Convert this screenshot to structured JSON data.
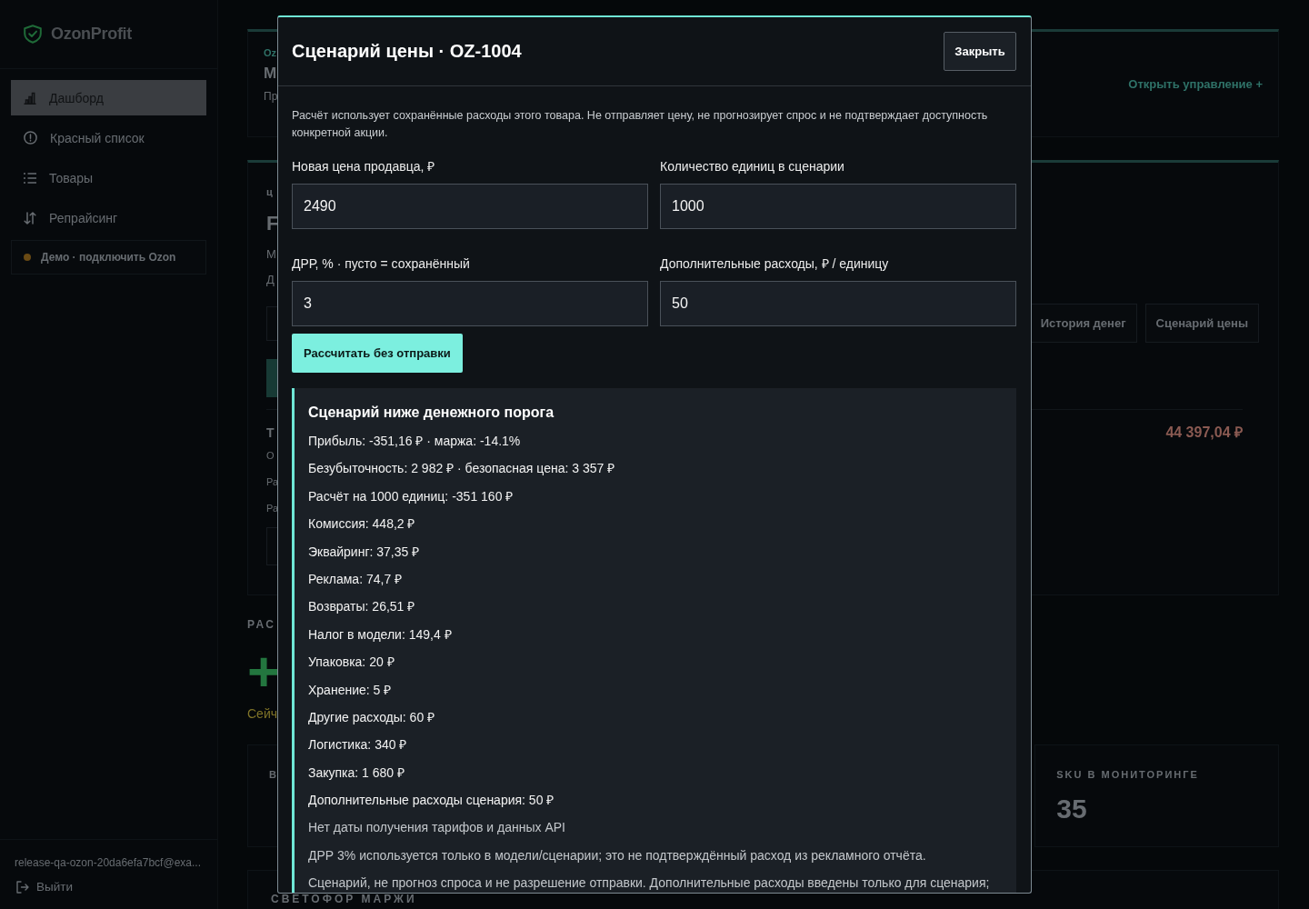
{
  "sidebar": {
    "logo": "OzonProfit",
    "items": [
      {
        "label": "Дашборд",
        "selected": true
      },
      {
        "label": "Красный список",
        "selected": false
      },
      {
        "label": "Товары",
        "selected": false
      },
      {
        "label": "Репрайсинг",
        "selected": false
      }
    ],
    "demo": {
      "label": "Демо · подключить Ozon",
      "color": "#6a4a14"
    },
    "user_email": "release-qa-ozon-20da6efa7bcf@exa...",
    "logout": "Выйти"
  },
  "page": {
    "header_card": {
      "eyebrow": "Oz",
      "title": "M",
      "subtitle": "Пр",
      "link": "Открыть управление +"
    },
    "product_card": {
      "eyebrow": "ц",
      "title": "F",
      "line_1": "М",
      "line_2": "Д",
      "buttons": [
        "История денег",
        "Сценарий цены"
      ],
      "section_title": "Т",
      "rows": [
        "O",
        "Ра",
        "Ра"
      ],
      "total": "44 397,04 ₽"
    },
    "section_label": "РАС",
    "big_value": "+",
    "status_text": "Сейч",
    "stats": [
      {
        "label": "В"
      },
      {
        "label": "SKU В МОНИТОРИНГЕ",
        "value": "35"
      }
    ],
    "bottom_card_title": "СВЕТОФОР МАРЖИ"
  },
  "modal": {
    "title": "Сценарий цены · OZ-1004",
    "close": "Закрыть",
    "description": "Расчёт использует сохранённые расходы этого товара. Не отправляет цену, не прогнозирует спрос и не подтверждает доступность конкретной акции.",
    "fields": [
      {
        "label": "Новая цена продавца, ₽",
        "value": "2490"
      },
      {
        "label": "Количество единиц в сценарии",
        "value": "1000"
      },
      {
        "label": "ДРР, % · пусто = сохранённый",
        "value": "3"
      },
      {
        "label": "Дополнительные расходы, ₽ / единицу",
        "value": "50"
      }
    ],
    "submit": "Рассчитать без отправки",
    "result": {
      "title": "Сценарий ниже денежного порога",
      "lines": [
        {
          "kind": "line",
          "text": "Прибыль: -351,16 ₽ · маржа: -14.1%"
        },
        {
          "kind": "line",
          "text": "Безубыточность: 2 982 ₽ · безопасная цена: 3 357 ₽"
        },
        {
          "kind": "line",
          "text": "Расчёт на 1000 единиц: -351 160 ₽"
        },
        {
          "kind": "line",
          "text": "Комиссия: 448,2 ₽"
        },
        {
          "kind": "line",
          "text": "Эквайринг: 37,35 ₽"
        },
        {
          "kind": "line",
          "text": "Реклама: 74,7 ₽"
        },
        {
          "kind": "line",
          "text": "Возвраты: 26,51 ₽"
        },
        {
          "kind": "line",
          "text": "Налог в модели: 149,4 ₽"
        },
        {
          "kind": "line",
          "text": "Упаковка: 20 ₽"
        },
        {
          "kind": "line",
          "text": "Хранение: 5 ₽"
        },
        {
          "kind": "line",
          "text": "Другие расходы: 60 ₽"
        },
        {
          "kind": "line",
          "text": "Логистика: 340 ₽"
        },
        {
          "kind": "line",
          "text": "Закупка: 1 680 ₽"
        },
        {
          "kind": "line",
          "text": "Дополнительные расходы сценария: 50 ₽"
        },
        {
          "kind": "note",
          "text": "Нет даты получения тарифов и данных API"
        },
        {
          "kind": "note",
          "text": "ДРР 3% используется только в модели/сценарии; это не подтверждённый расход из рекламного отчёта."
        },
        {
          "kind": "note",
          "text": "Сценарий, не прогноз спроса и не разрешение отправки. Дополнительные расходы введены только для сценария;"
        }
      ]
    }
  }
}
